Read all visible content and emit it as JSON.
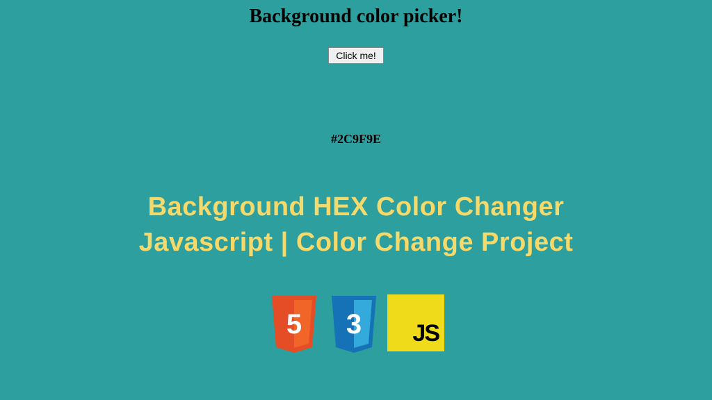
{
  "title": "Background color picker!",
  "button_label": "Click me!",
  "hex_value": "#2C9F9E",
  "headline_line1": "Background HEX Color Changer",
  "headline_line2": "Javascript | Color Change Project",
  "logos": {
    "html5_label": "5",
    "css3_label": "3",
    "js_label": "JS"
  }
}
